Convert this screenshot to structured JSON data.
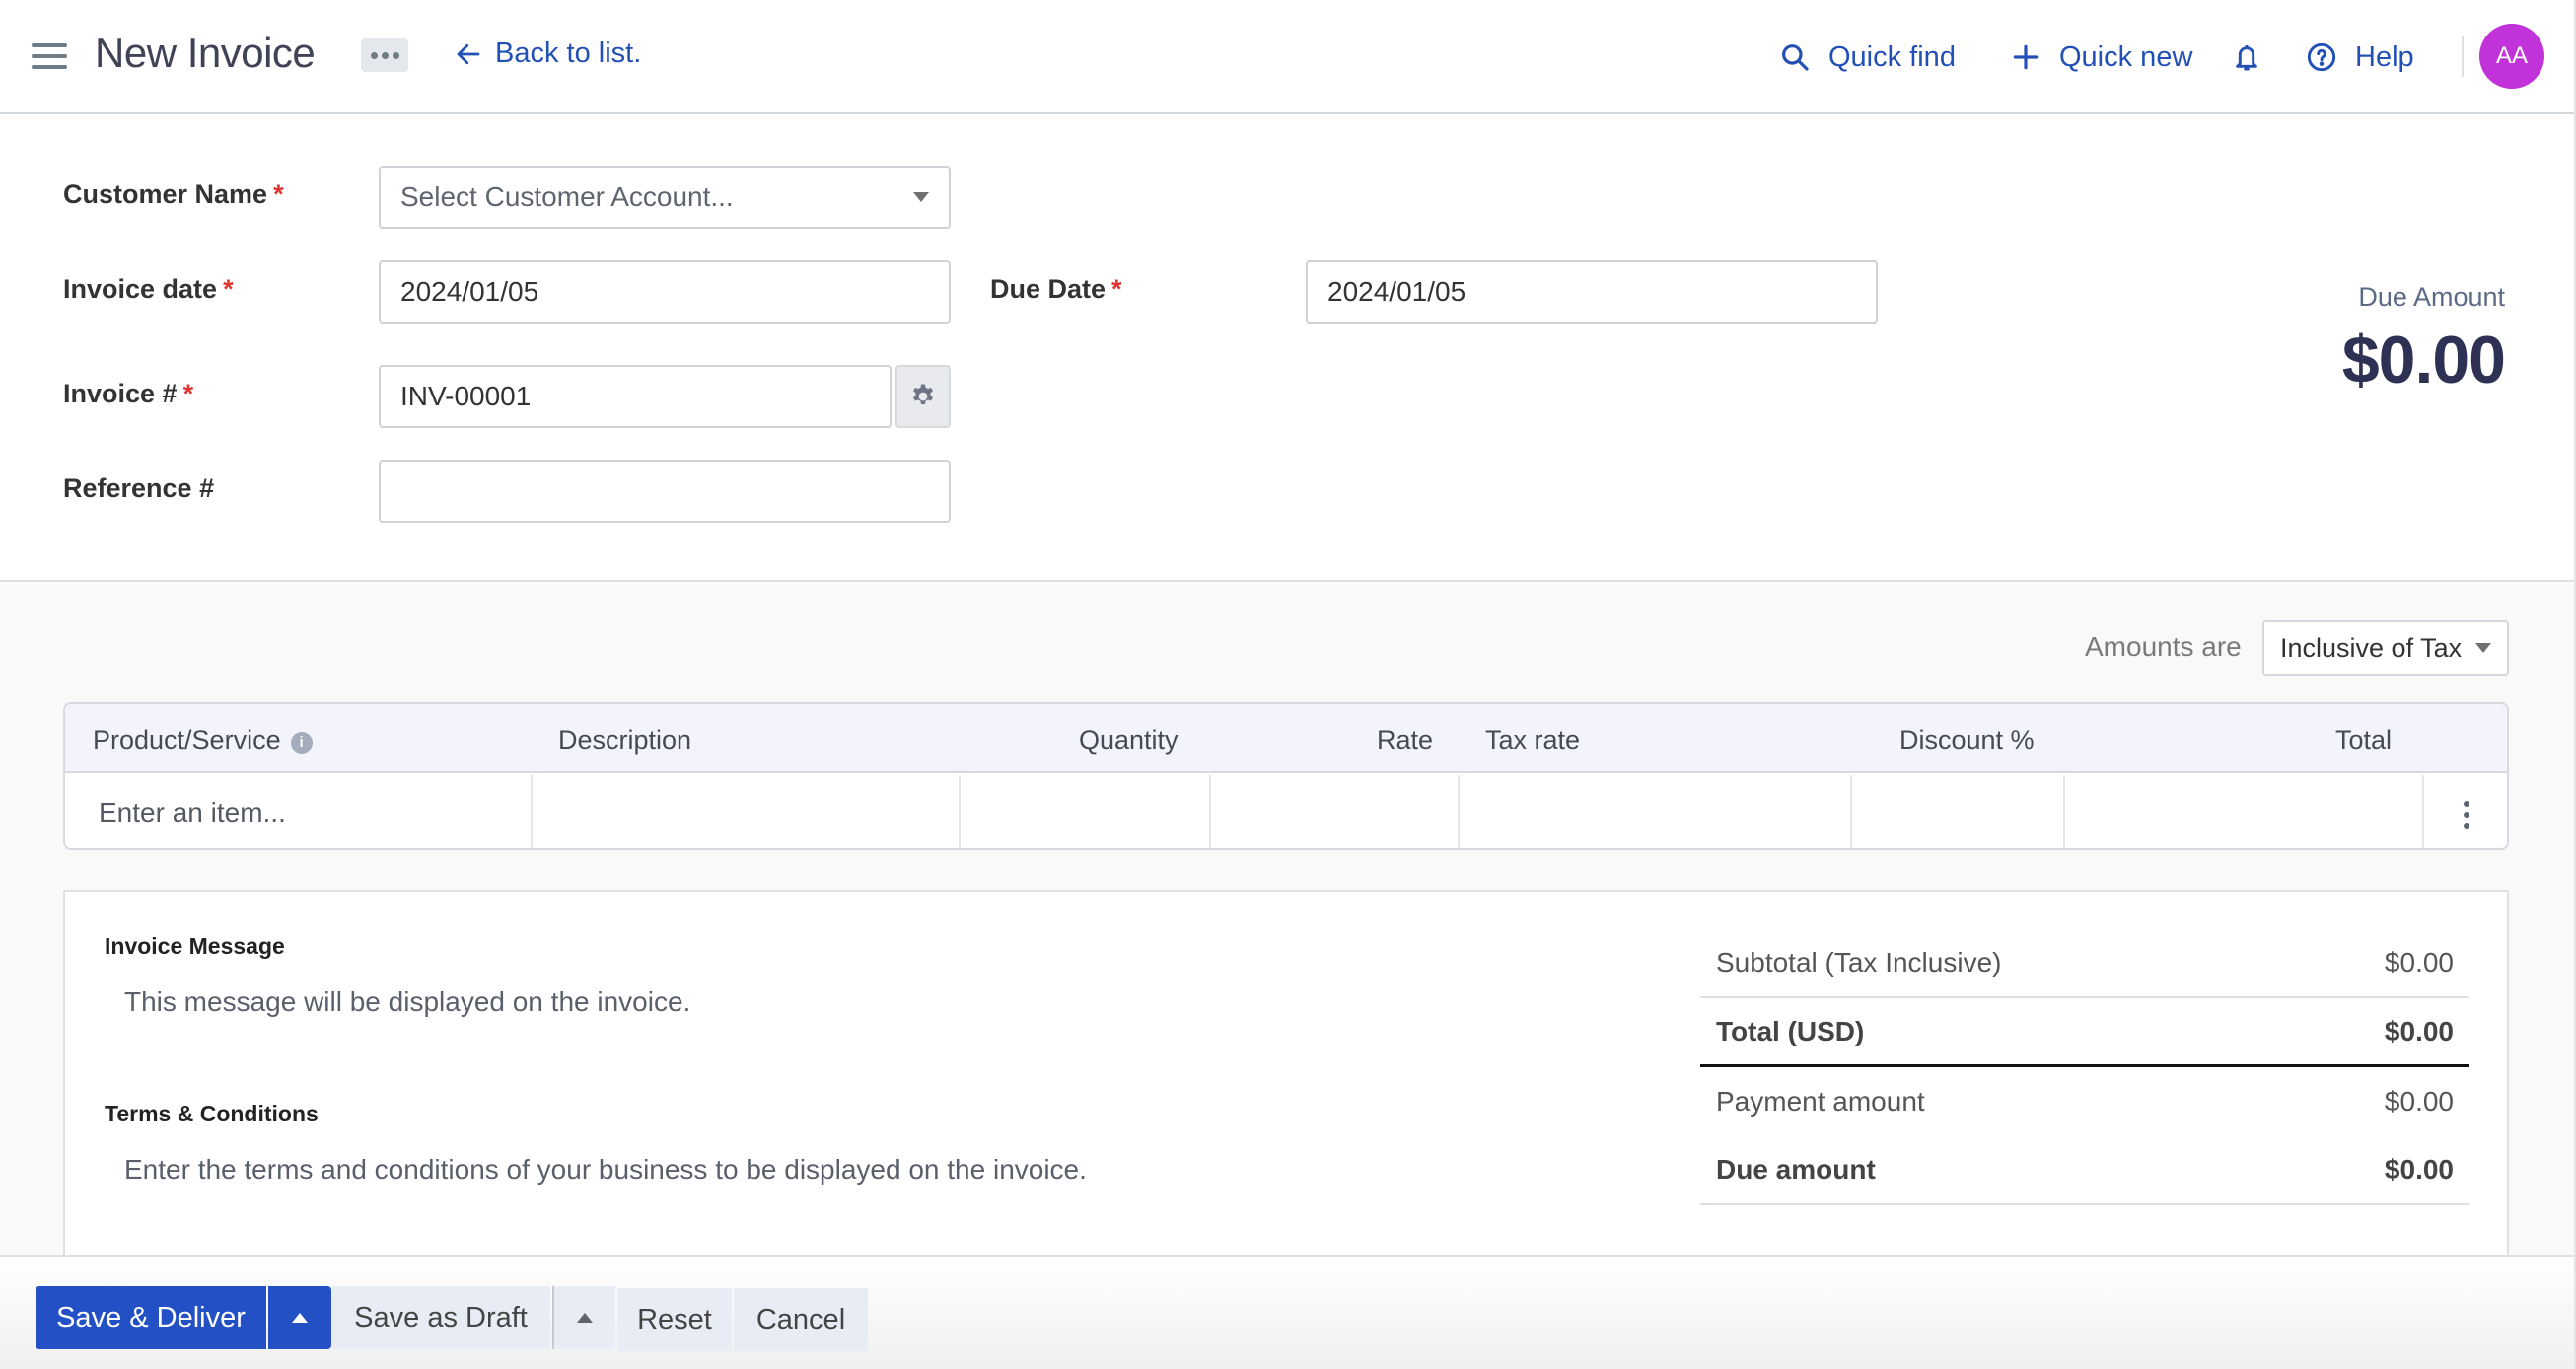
{
  "header": {
    "title": "New Invoice",
    "back_link": "Back to list.",
    "quick_find": "Quick find",
    "quick_new": "Quick new",
    "help": "Help",
    "avatar_initials": "AA",
    "icons": {
      "menu": "hamburger-icon",
      "more": "more-horizontal-icon",
      "back": "arrow-left-icon",
      "search": "search-icon",
      "plus": "plus-icon",
      "bell": "bell-icon",
      "help": "question-circle-icon"
    },
    "accent_color": "#2350b6",
    "avatar_color": "#c133d8"
  },
  "form": {
    "customer_name": {
      "label": "Customer Name",
      "required": "*",
      "placeholder": "Select Customer Account..."
    },
    "invoice_date": {
      "label": "Invoice date",
      "required": "*",
      "value": "2024/01/05"
    },
    "due_date": {
      "label": "Due Date",
      "required": "*",
      "value": "2024/01/05"
    },
    "invoice_number": {
      "label": "Invoice #",
      "required": "*",
      "value": "INV-00001"
    },
    "reference_number": {
      "label": "Reference #",
      "value": ""
    }
  },
  "due_summary": {
    "label": "Due Amount",
    "value": "$0.00"
  },
  "amounts": {
    "label": "Amounts are",
    "selected": "Inclusive of Tax"
  },
  "items_table": {
    "columns": [
      "Product/Service",
      "Description",
      "Quantity",
      "Rate",
      "Tax rate",
      "Discount %",
      "Total"
    ],
    "info_glyph": "i",
    "rows": [
      {
        "product_placeholder": "Enter an item...",
        "description": "",
        "quantity": "",
        "rate": "",
        "tax_rate": "",
        "discount": "",
        "total": ""
      }
    ]
  },
  "notes": {
    "invoice_message": {
      "title": "Invoice Message",
      "placeholder": "This message will be displayed on the invoice."
    },
    "terms": {
      "title": "Terms & Conditions",
      "placeholder": "Enter the terms and conditions of your business to be displayed on the invoice."
    }
  },
  "totals": [
    {
      "label": "Subtotal (Tax Inclusive)",
      "value": "$0.00"
    },
    {
      "label": "Total (USD)",
      "value": "$0.00"
    },
    {
      "label": "Payment amount",
      "value": "$0.00"
    },
    {
      "label": "Due amount",
      "value": "$0.00"
    }
  ],
  "actions": {
    "save_deliver": "Save & Deliver",
    "save_draft": "Save as Draft",
    "reset": "Reset",
    "cancel": "Cancel",
    "primary_color": "#2350c4"
  }
}
